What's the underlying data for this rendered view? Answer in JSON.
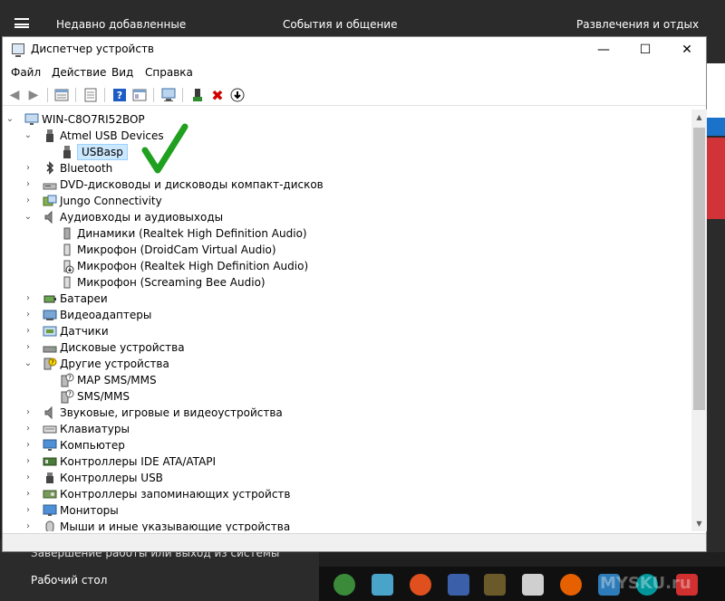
{
  "start_menu": {
    "recently_added": "Недавно добавленные",
    "events_comm": "События и общение",
    "entertainment": "Развлечения и отдых",
    "shutdown_hint": "Завершение работы или выход из системы",
    "desktop": "Рабочий стол"
  },
  "window": {
    "title": "Диспетчер устройств",
    "minimize": "—",
    "maximize": "☐",
    "close": "✕"
  },
  "menu": {
    "file": "Файл",
    "action": "Действие",
    "view": "Вид",
    "help": "Справка"
  },
  "tree": {
    "root": "WIN-C8O7RI52BOP",
    "atmel": "Atmel USB Devices",
    "usbasp": "USBasp",
    "bluetooth": "Bluetooth",
    "dvd": "DVD-дисководы и дисководы компакт-дисков",
    "jungo": "Jungo Connectivity",
    "audio_io": "Аудиовходы и аудиовыходы",
    "speakers": "Динамики (Realtek High Definition Audio)",
    "mic_droidcam": "Микрофон (DroidCam Virtual Audio)",
    "mic_realtek": "Микрофон (Realtek High Definition Audio)",
    "mic_screaming": "Микрофон (Screaming Bee Audio)",
    "batteries": "Батареи",
    "video": "Видеоадаптеры",
    "sensors": "Датчики",
    "disks": "Дисковые устройства",
    "other": "Другие устройства",
    "map_sms": "MAP SMS/MMS",
    "sms_mms": "SMS/MMS",
    "sound_game": "Звуковые, игровые и видеоустройства",
    "keyboards": "Клавиатуры",
    "computer": "Компьютер",
    "ide": "Контроллеры IDE ATA/ATAPI",
    "usb": "Контроллеры USB",
    "storage": "Контроллеры запоминающих устройств",
    "monitors": "Мониторы",
    "mice": "Мыши и иные указывающие устройства"
  },
  "watermark": "MYSKU.ru",
  "colors": {
    "selection": "#cce8ff",
    "check": "#1fa01f",
    "delete_red": "#d00000",
    "help_blue": "#1c5cc4"
  }
}
